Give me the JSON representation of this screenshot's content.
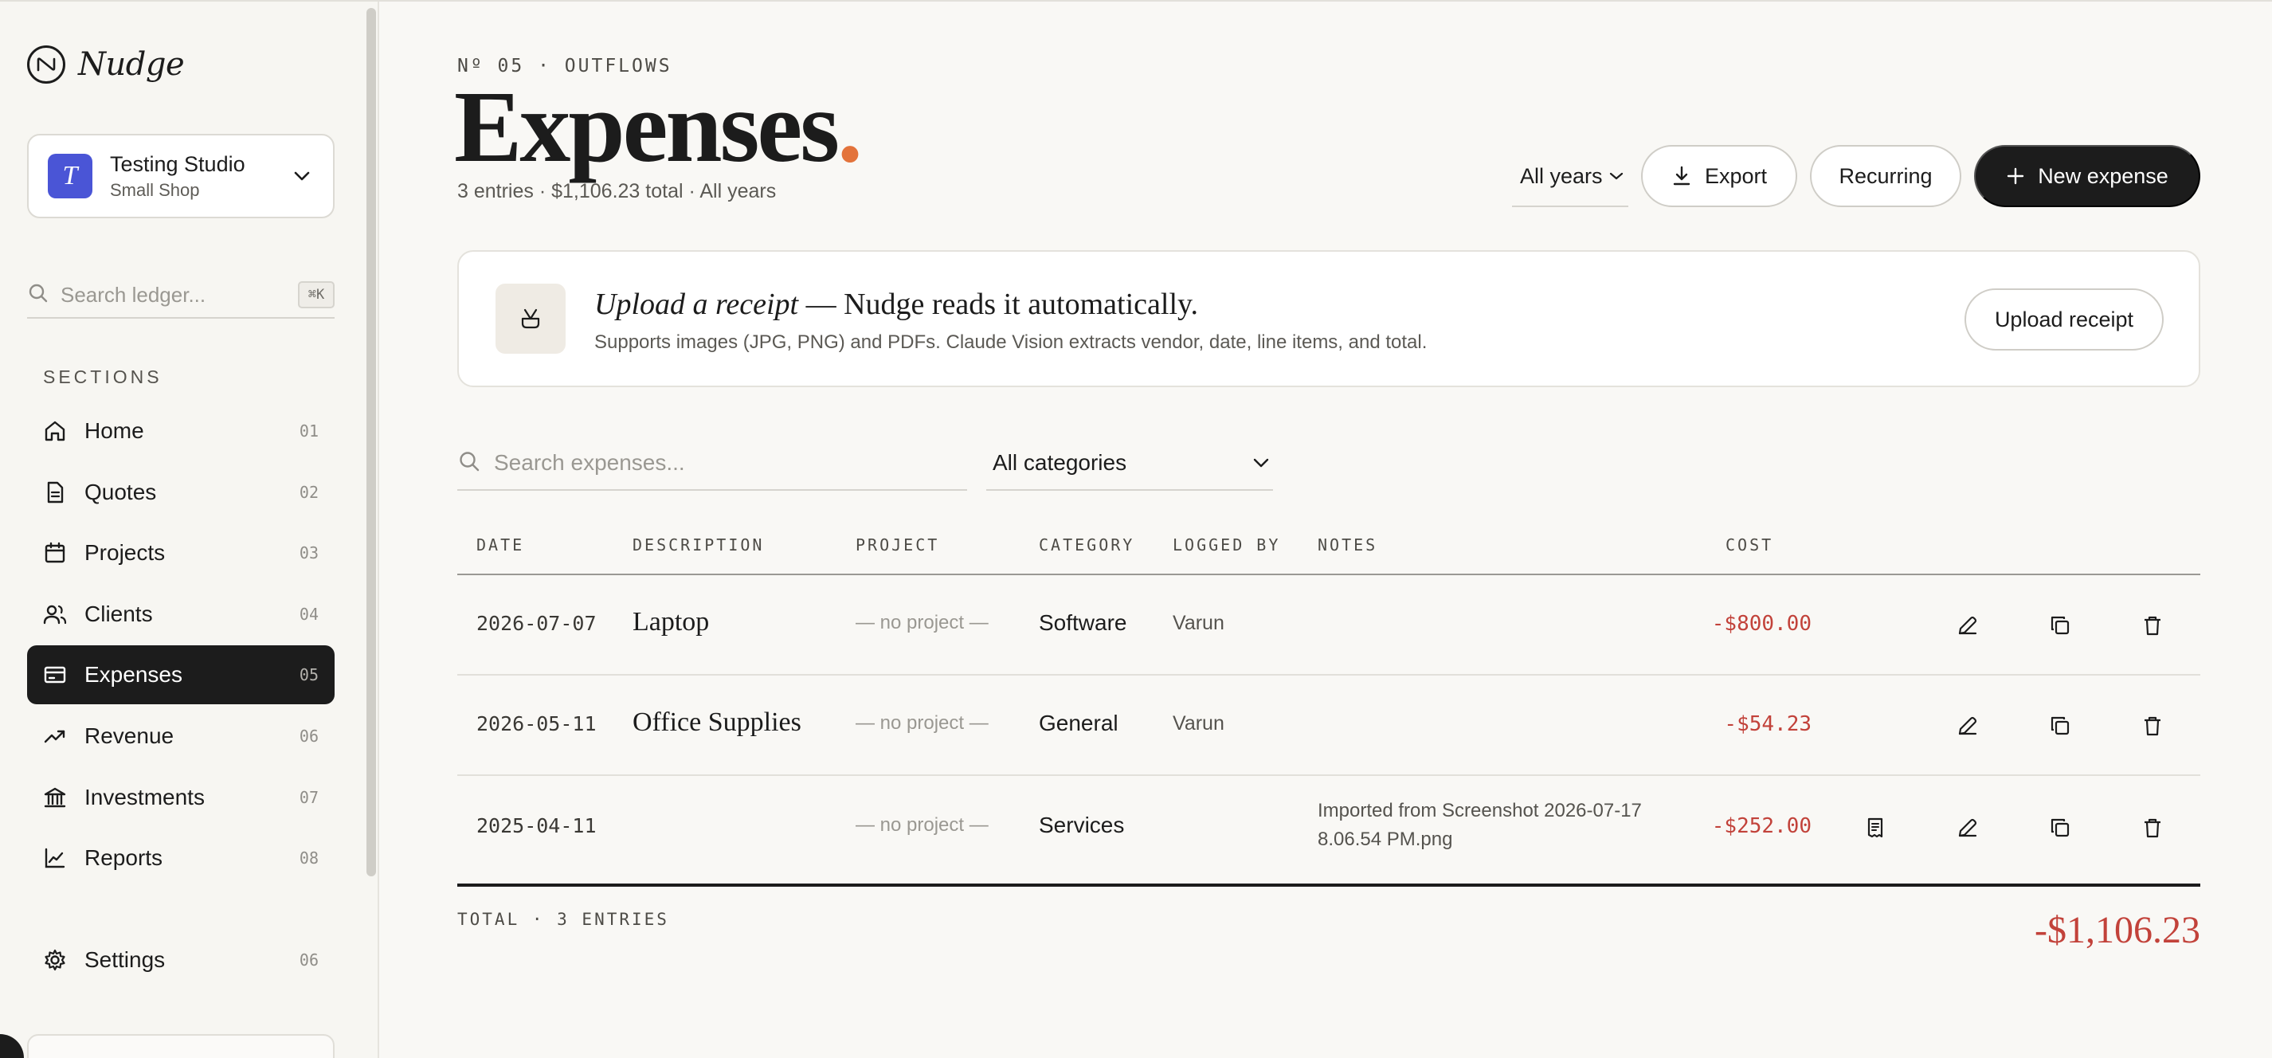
{
  "brand": {
    "name": "Nudge",
    "mark_icon": "nudge-logo-icon"
  },
  "workspace": {
    "initial": "T",
    "name": "Testing Studio",
    "plan": "Small Shop",
    "color": "#4a55d6"
  },
  "sidebar_search": {
    "placeholder": "Search ledger...",
    "shortcut": "⌘K"
  },
  "sidebar": {
    "section_label": "SECTIONS",
    "items": [
      {
        "label": "Home",
        "num": "01",
        "icon": "home-icon"
      },
      {
        "label": "Quotes",
        "num": "02",
        "icon": "document-icon"
      },
      {
        "label": "Projects",
        "num": "03",
        "icon": "calendar-icon"
      },
      {
        "label": "Clients",
        "num": "04",
        "icon": "users-icon"
      },
      {
        "label": "Expenses",
        "num": "05",
        "icon": "card-icon",
        "active": true
      },
      {
        "label": "Revenue",
        "num": "06",
        "icon": "trending-up-icon"
      },
      {
        "label": "Investments",
        "num": "07",
        "icon": "bank-icon"
      },
      {
        "label": "Reports",
        "num": "08",
        "icon": "line-chart-icon"
      }
    ],
    "settings": {
      "label": "Settings",
      "num": "06",
      "icon": "gear-icon"
    }
  },
  "header": {
    "eyebrow": "Nº 05 · OUTFLOWS",
    "title": "Expenses",
    "title_dot": ".",
    "subtitle": "3 entries · $1,106.23 total · All years",
    "year_filter": "All years",
    "export_label": "Export",
    "recurring_label": "Recurring",
    "new_label": "New expense"
  },
  "upload": {
    "headline_em": "Upload a receipt",
    "headline_rest": " — Nudge reads it automatically.",
    "desc": "Supports images (JPG, PNG) and PDFs. Claude Vision extracts vendor, date, line items, and total.",
    "button": "Upload receipt"
  },
  "filters": {
    "search_placeholder": "Search expenses...",
    "category": "All categories"
  },
  "table": {
    "headers": {
      "date": "DATE",
      "description": "DESCRIPTION",
      "project": "PROJECT",
      "category": "CATEGORY",
      "logged_by": "LOGGED BY",
      "notes": "NOTES",
      "cost": "COST"
    },
    "rows": [
      {
        "date": "2026-07-07",
        "description": "Laptop",
        "project": "— no project —",
        "category": "Software",
        "logged_by": "Varun",
        "notes": "",
        "cost": "-$800.00",
        "receipt": false
      },
      {
        "date": "2026-05-11",
        "description": "Office Supplies",
        "project": "— no project —",
        "category": "General",
        "logged_by": "Varun",
        "notes": "",
        "cost": "-$54.23",
        "receipt": false
      },
      {
        "date": "2025-04-11",
        "description": "",
        "project": "— no project —",
        "category": "Services",
        "logged_by": "",
        "notes": "Imported from Screenshot 2026-07-17 8.06.54 PM.png",
        "cost": "-$252.00",
        "receipt": true
      }
    ],
    "total_label": "TOTAL · 3 ENTRIES",
    "total_value": "-$1,106.23"
  },
  "colors": {
    "accent": "#e3733b",
    "negative": "#c2423a",
    "ink": "#1c1c1c",
    "background": "#f9f8f5"
  }
}
